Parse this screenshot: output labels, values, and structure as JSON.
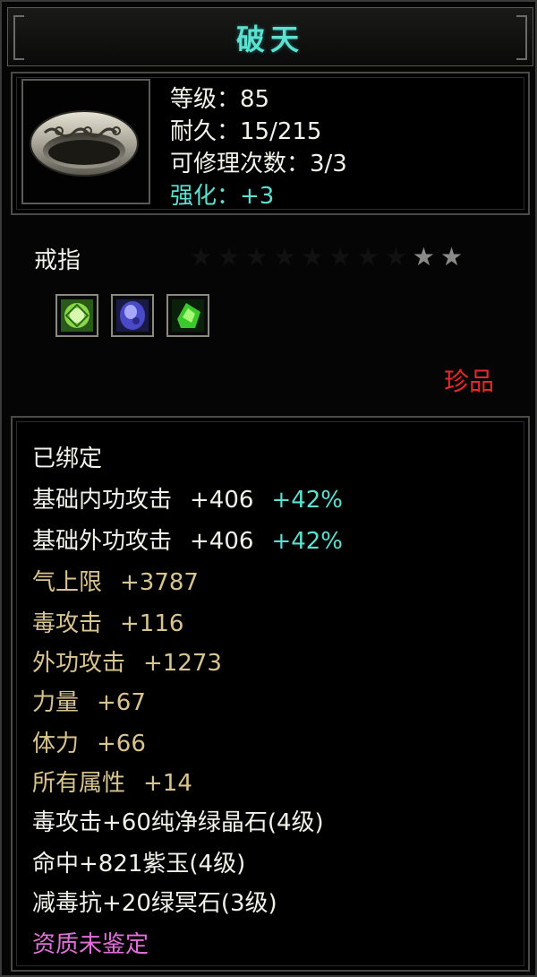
{
  "title": "破天",
  "info": {
    "level": "等级：85",
    "durability": "耐久：15/215",
    "repair": "可修理次数：3/3",
    "enhance": "强化：+3"
  },
  "item_type": "戒指",
  "stars": {
    "total": 10,
    "lit": 2
  },
  "gems": [
    "green-crystal-gem-icon",
    "purple-jade-gem-icon",
    "green-dark-stone-gem-icon"
  ],
  "rarity": "珍品",
  "attributes": {
    "bound": "已绑定",
    "base_inner": {
      "label": "基础内功攻击",
      "value": "+406",
      "pct": "+42%"
    },
    "base_outer": {
      "label": "基础外功攻击",
      "value": "+406",
      "pct": "+42%"
    },
    "qi": {
      "label": "气上限",
      "value": "+3787"
    },
    "poison": {
      "label": "毒攻击",
      "value": "+116"
    },
    "outer": {
      "label": "外功攻击",
      "value": "+1273"
    },
    "strength": {
      "label": "力量",
      "value": "+67"
    },
    "stamina": {
      "label": "体力",
      "value": "+66"
    },
    "all": {
      "label": "所有属性",
      "value": "+14"
    },
    "gem1": "毒攻击+60纯净绿晶石(4级)",
    "gem2": "命中+821紫玉(4级)",
    "gem3": "减毒抗+20绿冥石(3级)",
    "quality": "资质未鉴定"
  },
  "colors": {
    "title": "#5de0d0",
    "gold": "#d8c490",
    "cyan": "#5de0d0",
    "rarity": "#e82828",
    "quality": "#e070d8"
  }
}
